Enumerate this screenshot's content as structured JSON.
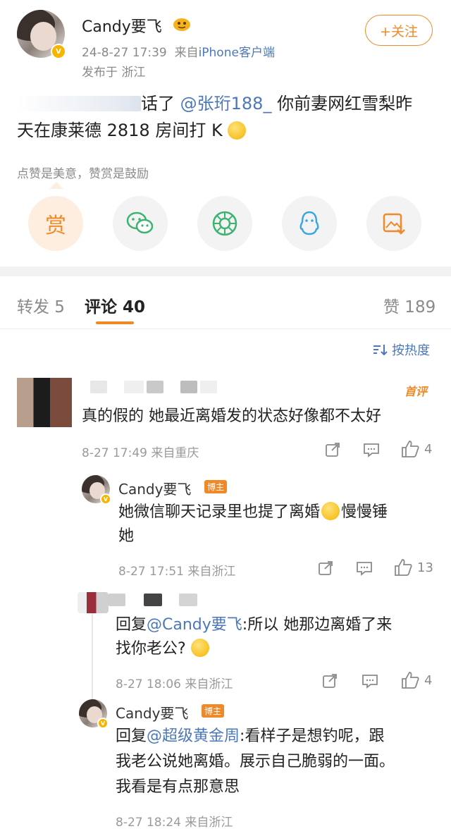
{
  "post": {
    "author": "Candy要飞",
    "time": "24-8-27 17:39",
    "source_prefix": "来自",
    "source": "iPhone客户端",
    "location": "发布于 浙江",
    "follow_label": "+关注",
    "text_head": "话了",
    "mention": "@张珩188_",
    "text_mid": " 你前妻网红雪梨昨",
    "text_line2": "天在康莱德 2818 房间打 K",
    "reward_hint": "点赞是美意，赞赏是鼓励",
    "reward_label": "赏"
  },
  "share_icons": [
    "wechat-icon",
    "moments-icon",
    "qq-icon",
    "save-image-icon"
  ],
  "tabs": {
    "repost": "转发 5",
    "comment": "评论 40",
    "like": "赞 189"
  },
  "sort_label": "按热度",
  "comments": [
    {
      "badge": "首评",
      "text": "真的假的 她最近离婚发的状态好像都不太好",
      "time": "8-27 17:49 来自重庆",
      "likes": "4"
    }
  ],
  "replies": [
    {
      "author": "Candy要飞",
      "tag": "博主",
      "text_line1": "她微信聊天记录里也提了离婚",
      "text_tail": "慢慢锤",
      "text_line2": "她",
      "time": "8-27 17:51 来自浙江",
      "likes": "13"
    },
    {
      "reply_prefix": "回复",
      "mention": "@Candy要飞",
      "text_line1": ":所以 她那边离婚了来",
      "text_line2": "找你老公?",
      "time": "8-27 18:06 来自浙江",
      "likes": "4"
    },
    {
      "author": "Candy要飞",
      "tag": "博主",
      "reply_prefix": "回复",
      "mention": "@超级黄金周",
      "text_line1": ":看样子是想钓呢，跟",
      "text_line2": "我老公说她离婚。展示自己脆弱的一面。",
      "text_line3": "我看是有点那意思",
      "time": "8-27 18:24 来自浙江"
    }
  ],
  "colors": {
    "accent": "#f08a28",
    "link": "#4c78b9",
    "wechat": "#3cb371",
    "qq": "#3aa6e0"
  }
}
